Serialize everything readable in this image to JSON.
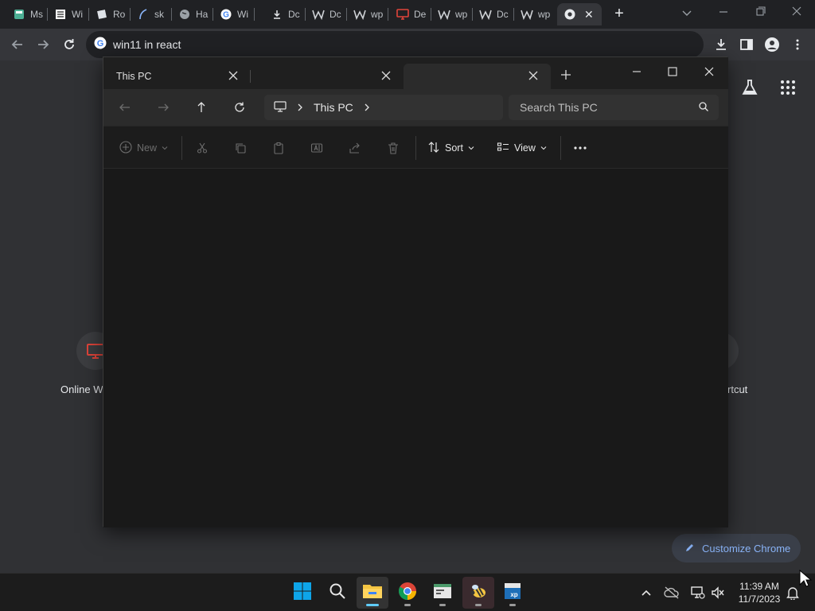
{
  "chrome": {
    "tabs": [
      {
        "label": "Ms",
        "icon": "calculator-icon"
      },
      {
        "label": "Wi",
        "icon": "wikipedia-icon"
      },
      {
        "label": "Ro",
        "icon": "doc-icon"
      },
      {
        "label": "sk",
        "icon": "feather-icon"
      },
      {
        "label": "Ha",
        "icon": "globe-icon"
      },
      {
        "label": "Wi",
        "icon": "google-icon"
      },
      {
        "label": "Dc",
        "icon": "download-icon"
      },
      {
        "label": "Dc",
        "icon": "w-icon"
      },
      {
        "label": "wp",
        "icon": "w-icon"
      },
      {
        "label": "De",
        "icon": "monitor-icon"
      },
      {
        "label": "wp",
        "icon": "w-icon"
      },
      {
        "label": "Dc",
        "icon": "w-icon"
      },
      {
        "label": "wp",
        "icon": "w-icon"
      }
    ],
    "omnibox_url": "win11 in react",
    "ntp": {
      "shortcut_left": "Online W",
      "shortcut_right": "rtcut",
      "customize_label": "Customize Chrome"
    }
  },
  "explorer": {
    "tabs": [
      {
        "label": "This PC"
      },
      {
        "label": ""
      },
      {
        "label": ""
      }
    ],
    "address": {
      "location": "This PC"
    },
    "search_placeholder": "Search This PC",
    "commands": {
      "new_label": "New",
      "sort_label": "Sort",
      "view_label": "View"
    }
  },
  "taskbar": {
    "time": "11:39 AM",
    "date": "11/7/2023"
  },
  "colors": {
    "accent": "#60cdff",
    "chrome_link": "#8ab4f8",
    "explorer_bg": "#191919"
  }
}
